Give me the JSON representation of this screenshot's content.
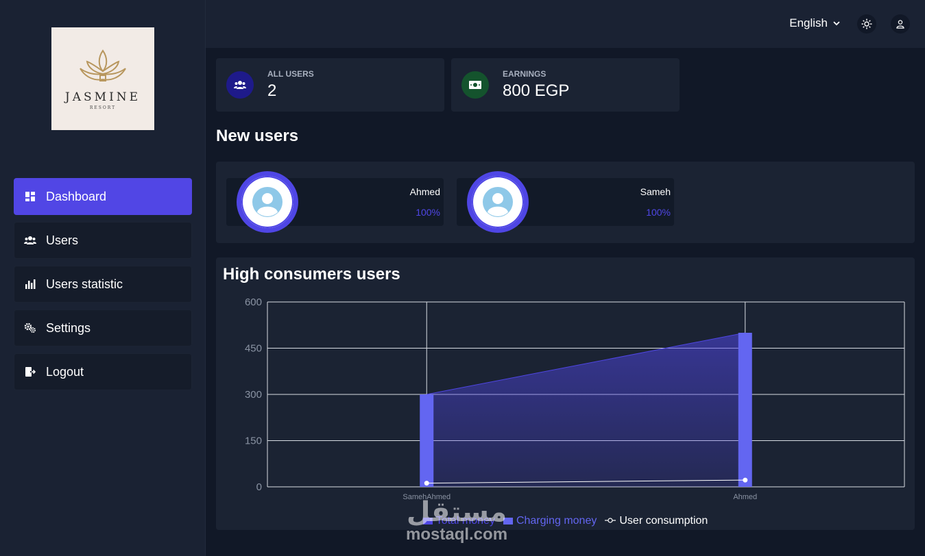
{
  "logo": {
    "title": "JASMINE",
    "subtitle": "RESORT"
  },
  "sidebar": {
    "items": [
      {
        "label": "Dashboard",
        "icon": "dashboard-icon",
        "active": true
      },
      {
        "label": "Users",
        "icon": "users-icon",
        "active": false
      },
      {
        "label": "Users statistic",
        "icon": "bar-chart-icon",
        "active": false
      },
      {
        "label": "Settings",
        "icon": "gears-icon",
        "active": false
      },
      {
        "label": "Logout",
        "icon": "logout-icon",
        "active": false
      }
    ]
  },
  "header": {
    "language": "English",
    "theme_icon": "sun-icon",
    "profile_icon": "user-icon"
  },
  "stats": [
    {
      "label": "ALL USERS",
      "value": "2",
      "icon": "users-icon",
      "color": "#1e1a8a"
    },
    {
      "label": "EARNINGS",
      "value": "800 EGP",
      "icon": "money-icon",
      "color": "#14532d"
    }
  ],
  "new_users": {
    "title": "New users",
    "users": [
      {
        "name": "Ahmed",
        "percent": "100%"
      },
      {
        "name": "Sameh",
        "percent": "100%"
      }
    ]
  },
  "chart_section": {
    "title": "High consumers users"
  },
  "chart_data": {
    "type": "bar",
    "categories": [
      "Sameh",
      "Ahmed"
    ],
    "category_ticks": [
      "SamehAhmed",
      "Ahmed"
    ],
    "ylim": [
      0,
      600
    ],
    "yticks": [
      "0",
      "150",
      "300",
      "450",
      "600"
    ],
    "grid": true,
    "legend": "bottom",
    "series": [
      {
        "name": "Total money",
        "type": "area",
        "values": [
          300,
          500
        ],
        "color": "#4f46e5"
      },
      {
        "name": "Charging money",
        "type": "bar",
        "values": [
          300,
          500
        ],
        "color": "#6366f1"
      },
      {
        "name": "User consumption",
        "type": "line",
        "values": [
          12,
          22
        ],
        "color": "#ffffff"
      }
    ]
  },
  "watermark": {
    "arabic": "مستقل",
    "latin": "mostaql.com"
  }
}
